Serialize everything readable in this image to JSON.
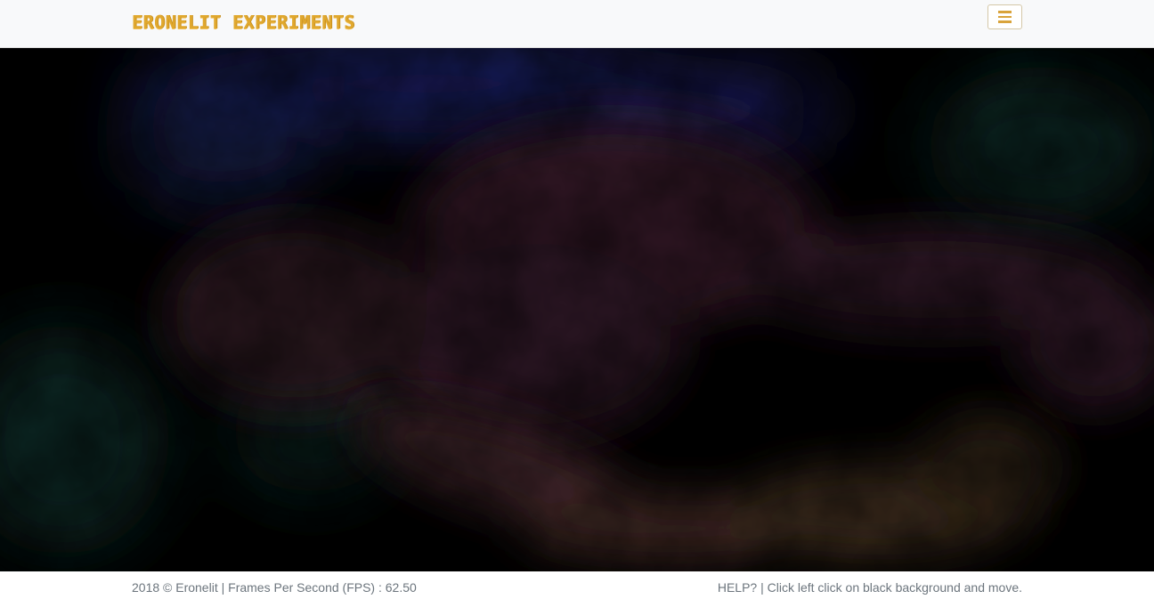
{
  "navbar": {
    "brand": "Eronelit Experiments",
    "toggler_icon": "hamburger-menu-icon",
    "accent_color": "#e0a82e"
  },
  "canvas": {
    "background_color": "#000000"
  },
  "footer": {
    "copyright": "2018 © Eronelit",
    "separator": "|",
    "fps_label": "Frames Per Second (FPS) :",
    "fps_value": "62.50",
    "help_label": "HELP?",
    "help_text": "Click left click on black background and move."
  }
}
